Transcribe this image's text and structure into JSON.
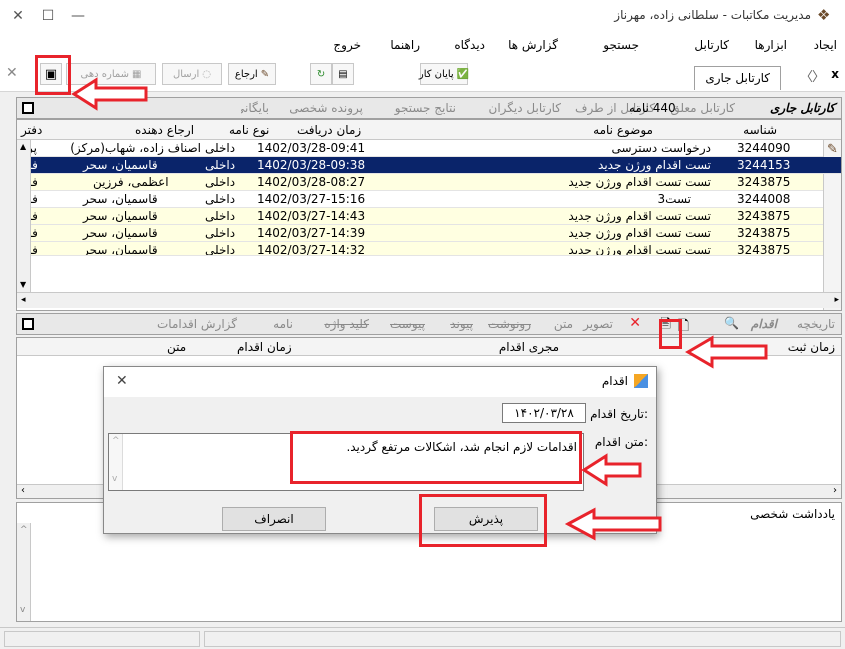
{
  "window": {
    "title": "مدیریت مکاتبات - سلطانی زاده، مهرناز",
    "controls": {
      "minimize": "—",
      "maximize": "☐",
      "close": "✕"
    }
  },
  "menu": [
    "ایجاد",
    "ابزارها",
    "کارتابل",
    "جستجو",
    "گزارش ها",
    "دیدگاه",
    "راهنما",
    "خروج"
  ],
  "toolbar": {
    "current_tab": "کارتابل جاری",
    "nav_back": "〈",
    "nav_forward": "〉",
    "close_x": "x",
    "end_work": "پایان کار",
    "refer": "ارجاع",
    "send": "ارسال",
    "sheet_number": "شماره دهی"
  },
  "folder_tabs": {
    "active": "کارتابل جاری",
    "items": [
      "کارتابل معلق",
      "کارتابل از طرف",
      "کارتابل دیگران",
      "نتایج جستجو",
      "پرونده شخصی",
      "بایگانی"
    ],
    "count": "440",
    "count_suffix": "نامه"
  },
  "grid": {
    "headers": {
      "id": "شناسه",
      "subject": "موضوع نامه",
      "received": "زمان دریافت",
      "type": "نوع نامه",
      "referrer": "ارجاع دهنده",
      "office": "دفتر"
    },
    "rows": [
      {
        "id": "3244090",
        "subject": "درخواست دسترسی",
        "received": "1402/03/28-09:41",
        "type": "داخلی",
        "referrer": "اصناف زاده، شهاب(مرکز)",
        "office": "پروژ"
      },
      {
        "id": "3244153",
        "subject": "تست اقدام ورژن جدید",
        "received": "1402/03/28-09:38",
        "type": "داخلی",
        "referrer": "قاسمیان، سحر",
        "office": "فن"
      },
      {
        "id": "3243875",
        "subject": "تست تست اقدام ورژن جدید",
        "received": "1402/03/28-08:27",
        "type": "داخلی",
        "referrer": "اعظمی، فرزین",
        "office": "فن"
      },
      {
        "id": "3244008",
        "subject": "تست3",
        "received": "1402/03/27-15:16",
        "type": "داخلی",
        "referrer": "قاسمیان، سحر",
        "office": "فن"
      },
      {
        "id": "3243875",
        "subject": "تست تست اقدام ورژن جدید",
        "received": "1402/03/27-14:43",
        "type": "داخلی",
        "referrer": "قاسمیان، سحر",
        "office": "فن"
      },
      {
        "id": "3243875",
        "subject": "تست تست اقدام ورژن جدید",
        "received": "1402/03/27-14:39",
        "type": "داخلی",
        "referrer": "قاسمیان، سحر",
        "office": "فن"
      },
      {
        "id": "3243875",
        "subject": "تست تست اقدام ورژن جدید",
        "received": "1402/03/27-14:32",
        "type": "داخلی",
        "referrer": "قاسمیان، سحر",
        "office": "فن"
      }
    ]
  },
  "lower_tabs": {
    "items": [
      "تاریخچه",
      "اقدام",
      "متن",
      "رونوشت",
      "پیوند",
      "پیوست",
      "کلید واژه",
      "نامه",
      "گزارش اقدامات"
    ],
    "image": "تصویر",
    "headers": {
      "reg_time": "زمان ثبت",
      "actor": "مجری اقدام",
      "action_time": "زمان اقدام",
      "text": "متن"
    }
  },
  "notes": {
    "label": "یادداشت شخصی"
  },
  "dialog": {
    "title": "اقدام",
    "date_label": "تاریخ اقدام:",
    "date_value": "۱۴۰۲/۰۳/۲۸",
    "text_label": "متن اقدام:",
    "text_value": "اقدامات لازم انجام شد، اشکالات مرتفع گردید.",
    "ok": "پذیرش",
    "cancel": "انصراف"
  },
  "colors": {
    "selection": "#0a246a",
    "highlight": "#ffffe1",
    "annotation": "#e8232b"
  }
}
